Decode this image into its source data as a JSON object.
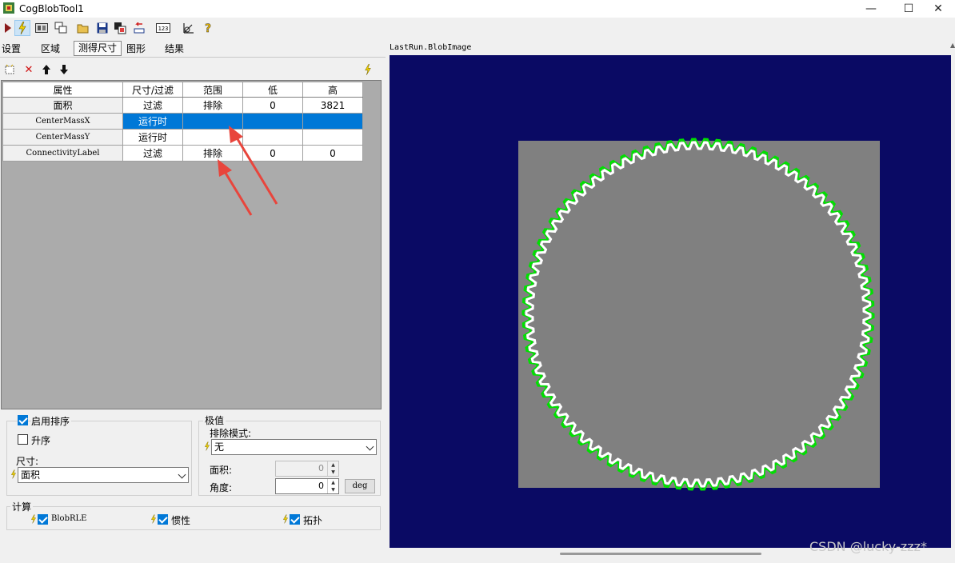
{
  "window": {
    "title": "CogBlobTool1",
    "minimize": "—",
    "maximize": "☐",
    "close": "✕"
  },
  "tabs": [
    {
      "label": "设置"
    },
    {
      "label": "区域"
    },
    {
      "label": "测得尺寸"
    },
    {
      "label": "图形"
    },
    {
      "label": "结果"
    }
  ],
  "grid": {
    "headers": [
      "属性",
      "尺寸/过滤",
      "范围",
      "低",
      "高"
    ],
    "rows": [
      {
        "property": "面积",
        "mode": "过滤",
        "range": "排除",
        "low": "0",
        "high": "3821"
      },
      {
        "property": "CenterMassX",
        "mode": "运行时",
        "range": "",
        "low": "",
        "high": ""
      },
      {
        "property": "CenterMassY",
        "mode": "运行时",
        "range": "",
        "low": "",
        "high": ""
      },
      {
        "property": "ConnectivityLabel",
        "mode": "过滤",
        "range": "排除",
        "low": "0",
        "high": "0"
      }
    ]
  },
  "sort": {
    "enable_label": "启用排序",
    "ascending_label": "升序",
    "size_label": "尺寸:",
    "size_value": "面积"
  },
  "extremum": {
    "title": "极值",
    "exclude_mode_label": "排除模式:",
    "exclude_mode_value": "无",
    "area_label": "面积:",
    "area_value": "0",
    "angle_label": "角度:",
    "angle_value": "0",
    "unit_button": "deg"
  },
  "compute": {
    "title": "计算",
    "items": [
      {
        "label": "BlobRLE"
      },
      {
        "label": "惯性"
      },
      {
        "label": "拓扑"
      }
    ]
  },
  "image": {
    "caption": "LastRun.BlobImage"
  },
  "watermark": "CSDN @lucky-zzz*",
  "colors": {
    "image_background": "#0a0a64",
    "blob_fill": "#808080",
    "selection": "#0078d7",
    "contour": "#00e000",
    "annotation_arrow": "#e8453c"
  }
}
